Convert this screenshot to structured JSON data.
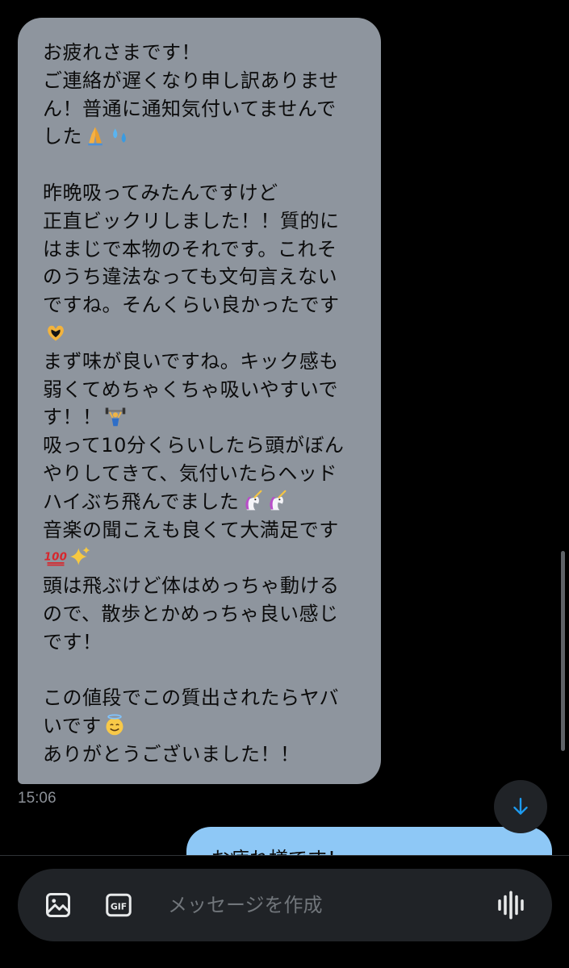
{
  "received_message": {
    "lines": [
      "お疲れさまです！",
      "ご連絡が遅くなり申し訳ありませ",
      "ん！普通に通知気付いてませんで",
      "した",
      "",
      "昨晩吸ってみたんですけど",
      "正直ビックリしました！！質的に",
      "はまじで本物のそれです。これそ",
      "のうち違法なっても文句言えない",
      "ですね。そんくらい良かったです",
      "",
      "まず味が良いですね。キック感も",
      "弱くてめちゃくちゃ吸いやすいで",
      "す！！",
      "吸って10分くらいしたら頭がぼん",
      "やりしてきて、気付いたらヘッド",
      "ハイぶち飛んでました",
      "音楽の聞こえも良くて大満足です",
      "",
      "頭は飛ぶけど体はめっちゃ動ける",
      "ので、散歩とかめっちゃ良い感じ",
      "です！",
      "",
      "この値段でこの質出されたらヤバ",
      "いです",
      "ありがとうございました！！"
    ],
    "emojis": {
      "3": [
        "folded-hands-emoji",
        "sweat-droplets-emoji"
      ],
      "10": [
        "heart-hands-emoji"
      ],
      "13": [
        "weight-lifter-emoji"
      ],
      "16": [
        "unicorn-emoji",
        "unicorn-emoji"
      ],
      "18": [
        "hundred-points-emoji",
        "sparkles-emoji"
      ],
      "24": [
        "smiling-face-with-halo-emoji"
      ]
    },
    "timestamp": "15:06"
  },
  "sent_message": {
    "text": "お疲れ様です！"
  },
  "composer": {
    "placeholder": "メッセージを作成"
  },
  "icons": {
    "scroll_down": "arrow-down-icon",
    "image": "image-icon",
    "gif": "gif-icon",
    "voice": "voice-message-icon"
  },
  "colors": {
    "background": "#000000",
    "received_bubble": "#8e959e",
    "sent_bubble": "#8ec8f6",
    "accent": "#1d9bf0",
    "composer_bg": "#202327",
    "placeholder": "#71767b",
    "timestamp": "#8b9097"
  }
}
